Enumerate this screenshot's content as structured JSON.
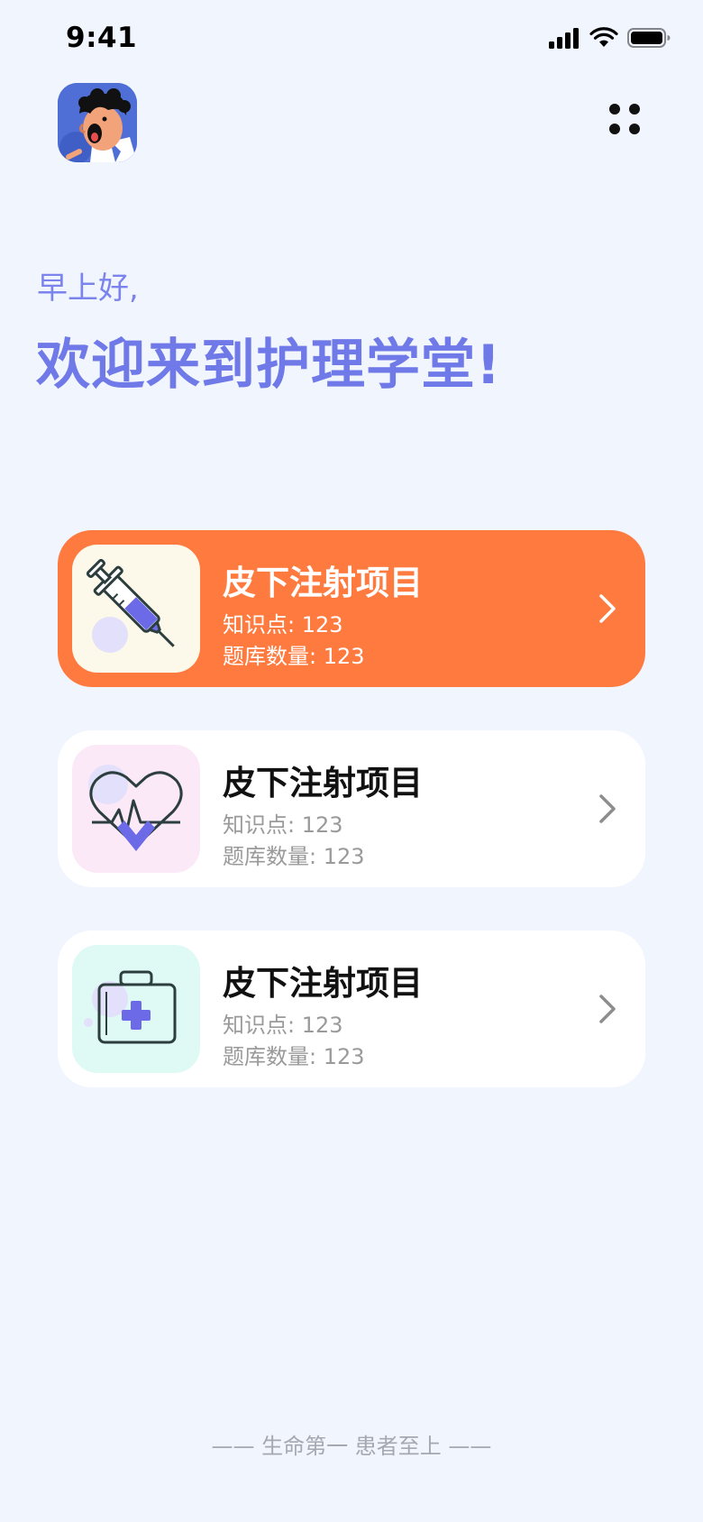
{
  "status_bar": {
    "time": "9:41"
  },
  "header": {
    "avatar": "doctor-cartoon-avatar",
    "menu_icon": "grid-dots-icon"
  },
  "greeting": "早上好,",
  "welcome": "欢迎来到护理学堂!",
  "cards": [
    {
      "title": "皮下注射项目",
      "knowledge": "知识点:  123",
      "questions": "题库数量:  123",
      "icon": "syringe-icon",
      "active": true
    },
    {
      "title": "皮下注射项目",
      "knowledge": "知识点:  123",
      "questions": "题库数量:  123",
      "icon": "heartbeat-icon",
      "active": false
    },
    {
      "title": "皮下注射项目",
      "knowledge": "知识点:  123",
      "questions": "题库数量:  123",
      "icon": "first-aid-kit-icon",
      "active": false
    }
  ],
  "footer": {
    "slogan": "—— 生命第一 患者至上 ——"
  },
  "colors": {
    "accent": "#ff7a3f",
    "title_purple": "#7079e8",
    "background": "#f1f5fe"
  }
}
